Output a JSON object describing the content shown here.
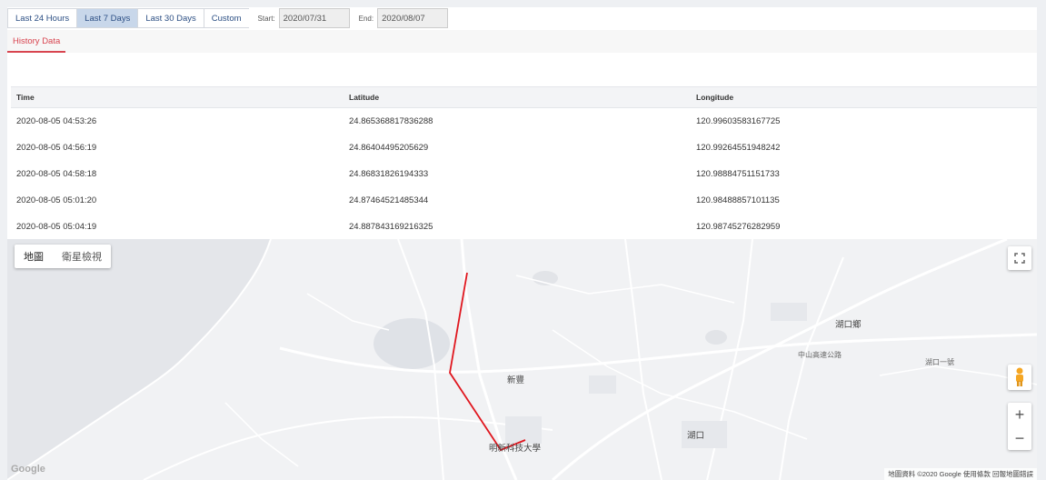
{
  "range": {
    "buttons": [
      "Last 24 Hours",
      "Last 7 Days",
      "Last 30 Days",
      "Custom"
    ],
    "active_index": 1,
    "start_label": "Start:",
    "start_value": "2020/07/31",
    "end_label": "End:",
    "end_value": "2020/08/07"
  },
  "tab": {
    "label": "History Data"
  },
  "table": {
    "headers": [
      "Time",
      "Latitude",
      "Longitude"
    ],
    "rows": [
      [
        "2020-08-05 04:53:26",
        "24.865368817836288",
        "120.99603583167725"
      ],
      [
        "2020-08-05 04:56:19",
        "24.86404495205629",
        "120.99264551948242"
      ],
      [
        "2020-08-05 04:58:18",
        "24.86831826194333",
        "120.98884751151733"
      ],
      [
        "2020-08-05 05:01:20",
        "24.87464521485344",
        "120.98488857101135"
      ],
      [
        "2020-08-05 05:04:19",
        "24.887843169216325",
        "120.98745276282959"
      ]
    ]
  },
  "map": {
    "type_map_label": "地圖",
    "type_satellite_label": "衛星檢視",
    "fullscreen_icon": "fullscreen-icon",
    "zoom_in": "+",
    "zoom_out": "−",
    "logo_text": "Google",
    "attribution": "地圖資料 ©2020 Google   使用條款   回報地圖錯誤",
    "labels": {
      "hukou_township": "湖口鄉",
      "zhongshan_rd": "中山高速公路",
      "xinfeng": "新豐",
      "hukou": "湖口",
      "mingxin": "明新科技大學",
      "daqiao": "湖口一號"
    },
    "route_color": "#e0161e"
  }
}
